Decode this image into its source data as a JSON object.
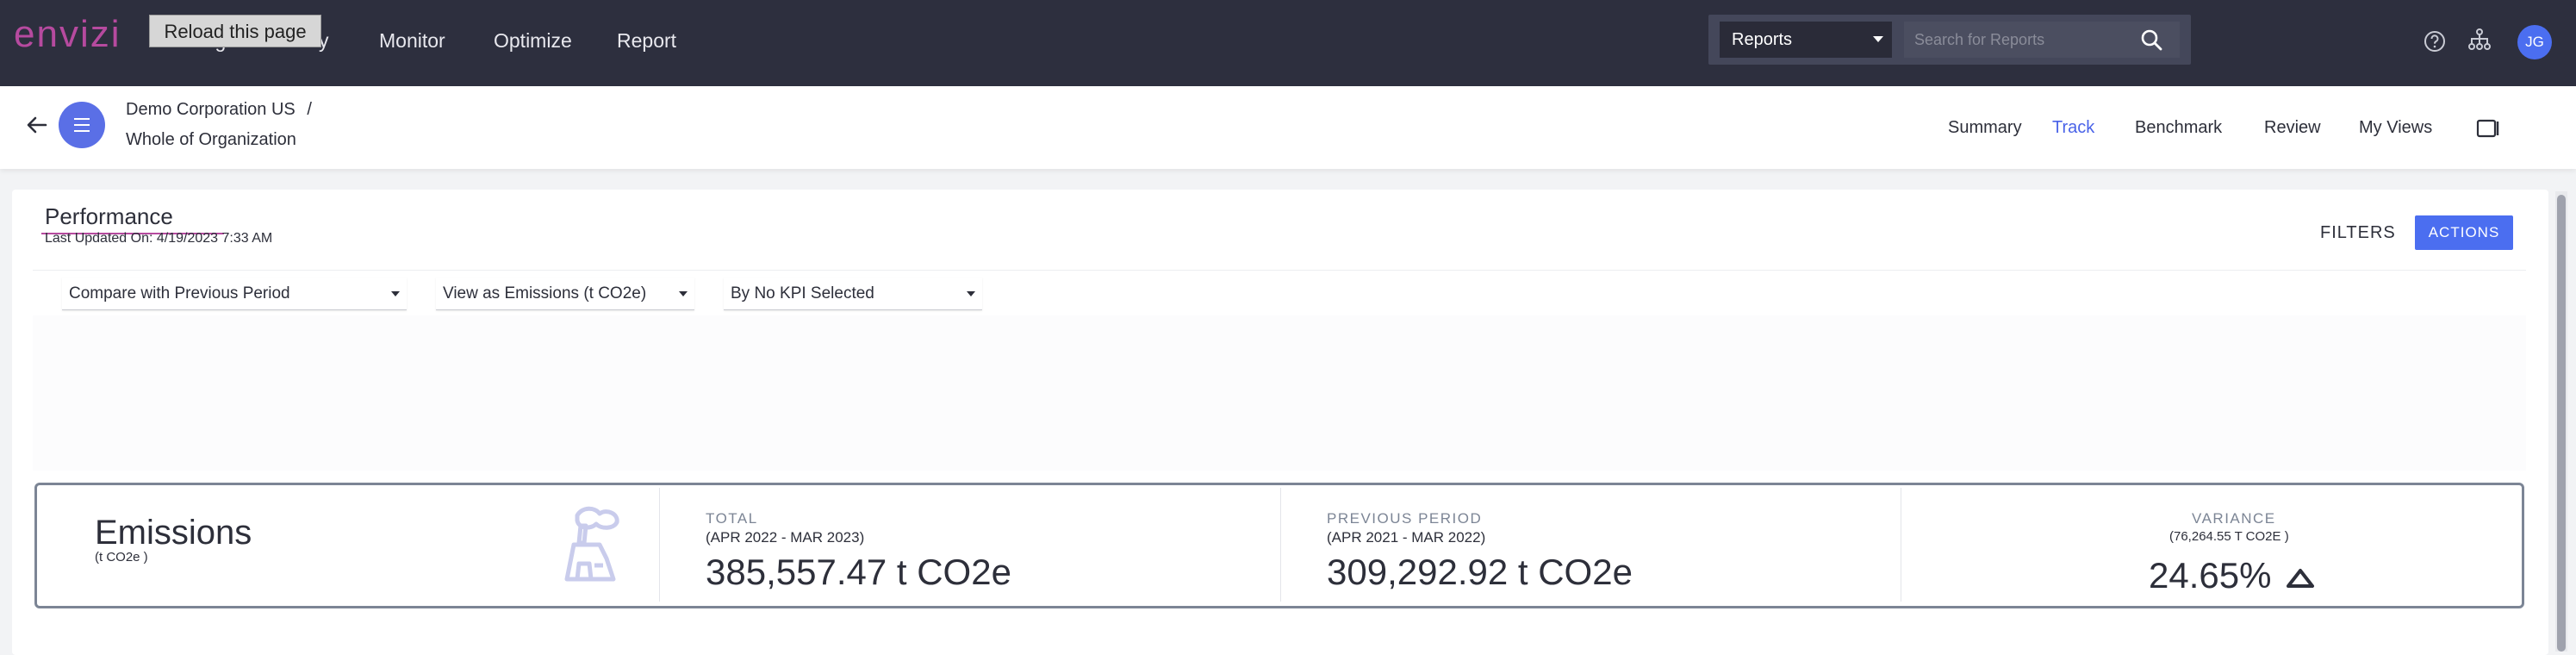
{
  "header": {
    "logo": "envizi",
    "tooltip": "Reload this page",
    "nav": [
      "Manage",
      "Verify",
      "Monitor",
      "Optimize",
      "Report"
    ],
    "report_select": "Reports",
    "search_placeholder": "Search for Reports",
    "avatar_initials": "JG",
    "icons": [
      "help-icon",
      "hierarchy-icon",
      "search-icon"
    ]
  },
  "subheader": {
    "breadcrumb_org": "Demo Corporation US",
    "breadcrumb_sep": "/",
    "breadcrumb_scope": "Whole of Organization",
    "tabs": [
      "Summary",
      "Track",
      "Benchmark",
      "Review",
      "My Views"
    ],
    "active_tab": "Track"
  },
  "performance": {
    "title": "Performance",
    "last_updated": "Last Updated On: 4/19/2023 7:33 AM",
    "filters_label": "FILTERS",
    "actions_label": "ACTIONS",
    "compare_select": "Compare with Previous Period",
    "view_select": "View as Emissions (t CO2e)",
    "kpi_select": "By No KPI Selected"
  },
  "summary": {
    "title": "Emissions",
    "unit": "(t CO2e )",
    "total_label": "TOTAL",
    "total_range": "(APR 2022 - MAR 2023)",
    "total_value": "385,557.47 t CO2e",
    "prev_label": "PREVIOUS PERIOD",
    "prev_range": "(APR 2021 - MAR 2022)",
    "prev_value": "309,292.92 t CO2e",
    "variance_label": "VARIANCE",
    "variance_sub": "(76,264.55 T CO2E )",
    "variance_value": "24.65%"
  },
  "colors": {
    "topbar": "#2d2f3e",
    "brand": "#b64a9f",
    "accent": "#4b6ef0"
  }
}
